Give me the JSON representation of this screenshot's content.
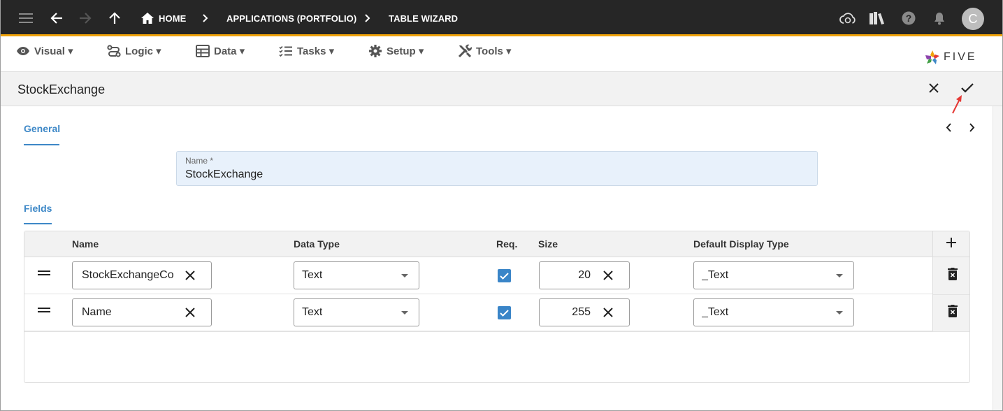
{
  "appbar": {
    "breadcrumbs": [
      "HOME",
      "APPLICATIONS (PORTFOLIO)",
      "TABLE WIZARD"
    ],
    "avatar_initial": "C",
    "icons": [
      "menu-icon",
      "back-arrow-icon",
      "forward-arrow-icon",
      "up-arrow-icon",
      "home-icon",
      "chevron-right-icon",
      "cloud-sync-icon",
      "library-icon",
      "help-icon",
      "bell-icon"
    ]
  },
  "menubar": {
    "items": [
      {
        "label": "Visual ▾",
        "icon": "eye-icon"
      },
      {
        "label": "Logic ▾",
        "icon": "logic-icon"
      },
      {
        "label": "Data ▾",
        "icon": "table-icon"
      },
      {
        "label": "Tasks ▾",
        "icon": "tasks-icon"
      },
      {
        "label": "Setup ▾",
        "icon": "gear-icon"
      },
      {
        "label": "Tools ▾",
        "icon": "tools-icon"
      }
    ],
    "logo_text": "FIVE"
  },
  "form": {
    "title": "StockExchange",
    "tab_general": "General",
    "tab_fields": "Fields",
    "name_label": "Name *",
    "name_value": "StockExchange"
  },
  "table": {
    "headers": {
      "name": "Name",
      "data_type": "Data Type",
      "req": "Req.",
      "size": "Size",
      "display_type": "Default Display Type"
    },
    "rows": [
      {
        "name": "StockExchangeCo",
        "data_type": "Text",
        "req": true,
        "size": "20",
        "display_type": "_Text"
      },
      {
        "name": "Name",
        "data_type": "Text",
        "req": true,
        "size": "255",
        "display_type": "_Text"
      }
    ]
  },
  "colors": {
    "accent": "#3e88c7",
    "appbar": "#262626",
    "appbar_border": "#f0a30a",
    "checkbox": "#3a85c8",
    "annotation_arrow": "#e53935"
  }
}
